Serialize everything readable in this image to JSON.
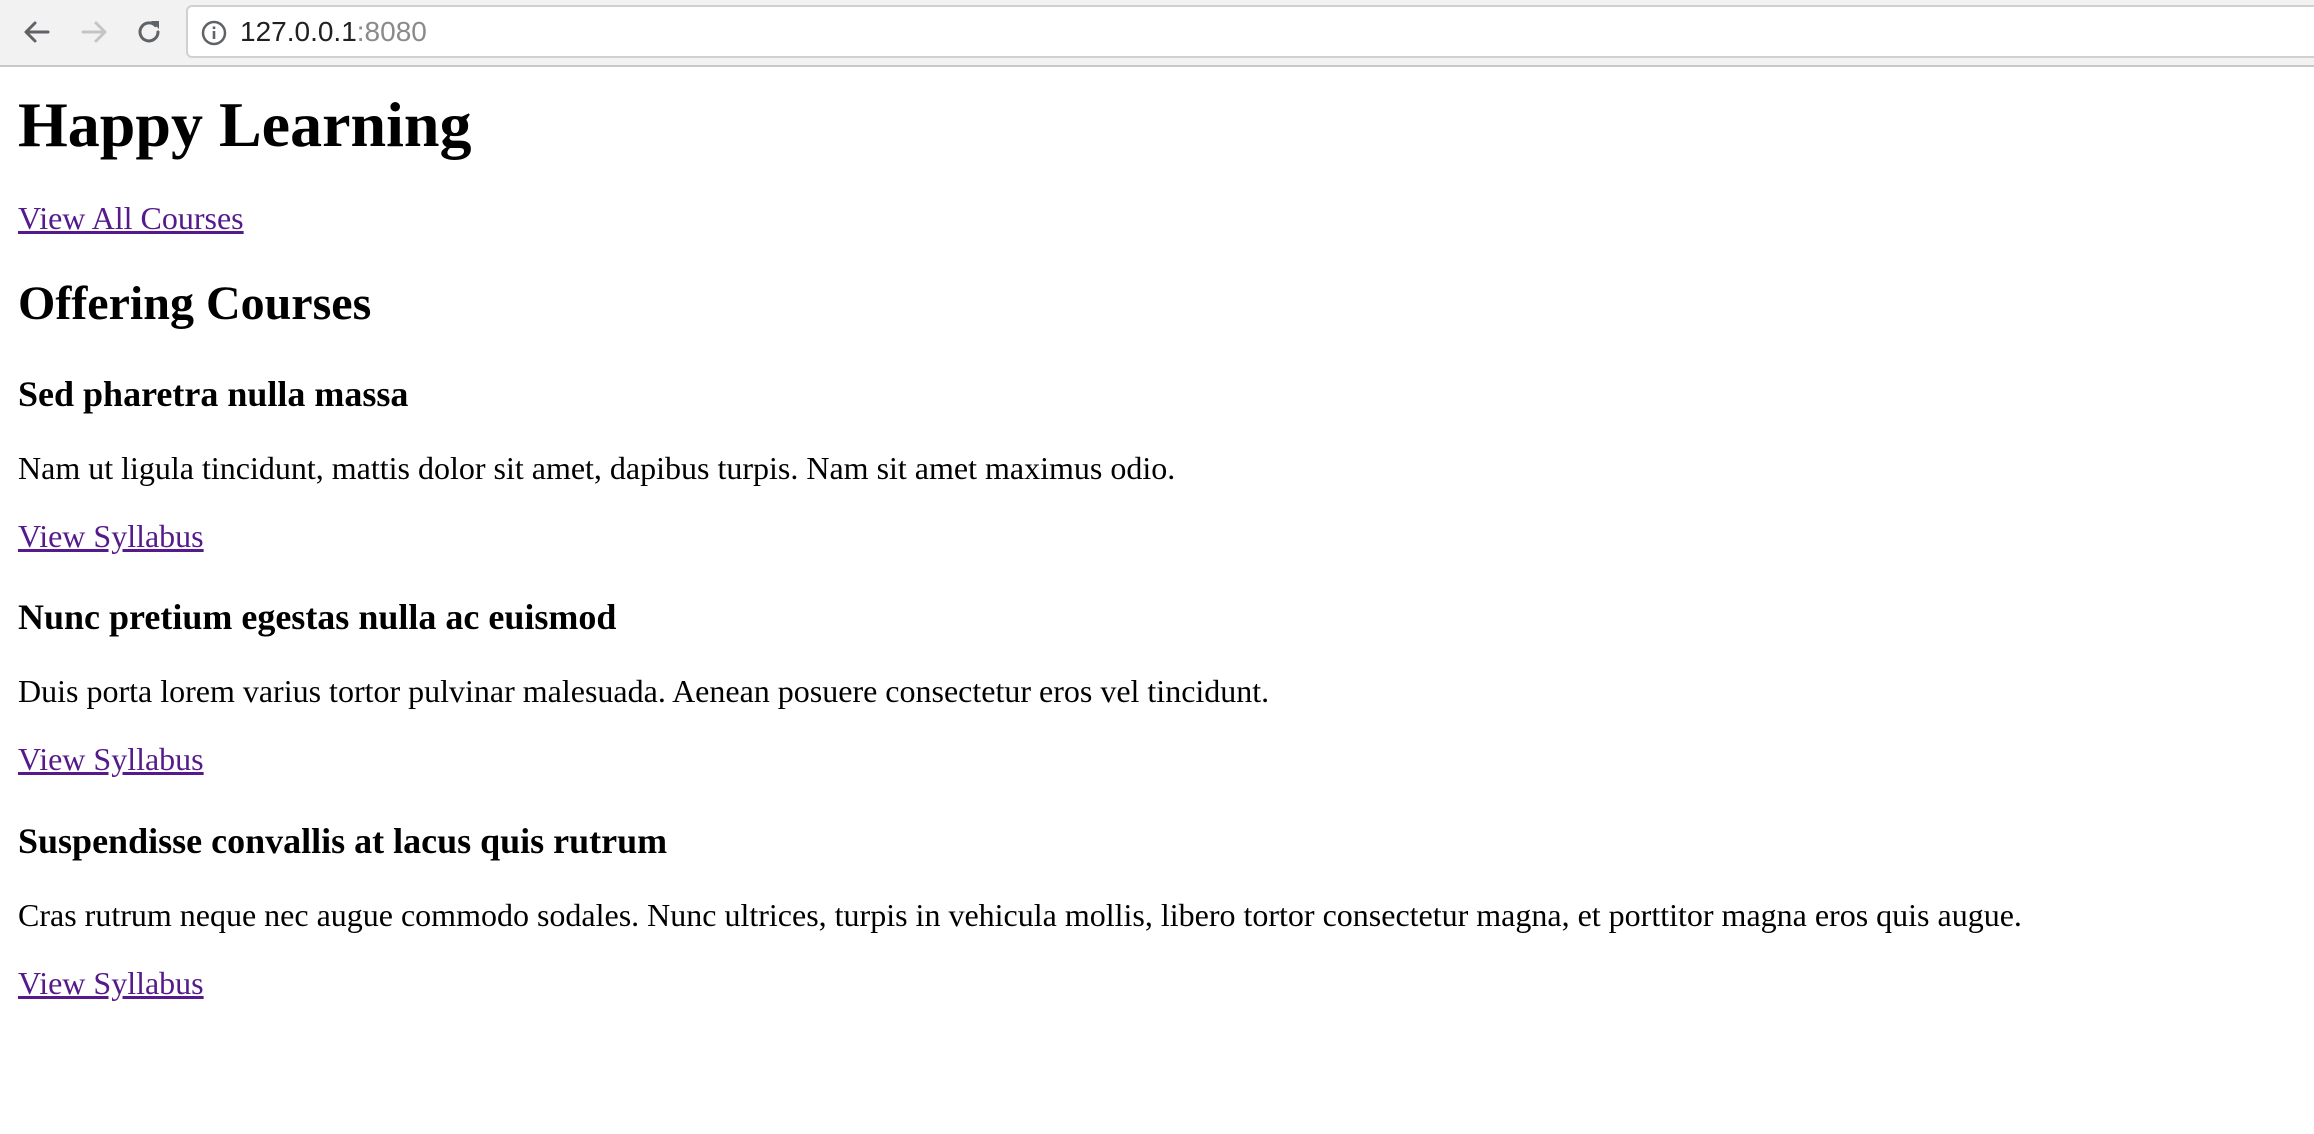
{
  "browser": {
    "url_host": "127.0.0.1",
    "url_port": ":8080",
    "back_icon": "arrow-left-icon",
    "forward_icon": "arrow-right-icon",
    "reload_icon": "reload-icon",
    "info_icon": "info-circle-icon"
  },
  "page": {
    "title": "Happy Learning",
    "view_all_link": "View All Courses",
    "section_title": "Offering Courses",
    "link_color": "#551a8b",
    "courses": [
      {
        "title": "Sed pharetra nulla massa",
        "description": "Nam ut ligula tincidunt, mattis dolor sit amet, dapibus turpis. Nam sit amet maximus odio.",
        "link": "View Syllabus"
      },
      {
        "title": "Nunc pretium egestas nulla ac euismod",
        "description": "Duis porta lorem varius tortor pulvinar malesuada. Aenean posuere consectetur eros vel tincidunt.",
        "link": "View Syllabus"
      },
      {
        "title": "Suspendisse convallis at lacus quis rutrum",
        "description": "Cras rutrum neque nec augue commodo sodales. Nunc ultrices, turpis in vehicula mollis, libero tortor consectetur magna, et porttitor magna eros quis augue.",
        "link": "View Syllabus"
      }
    ]
  }
}
